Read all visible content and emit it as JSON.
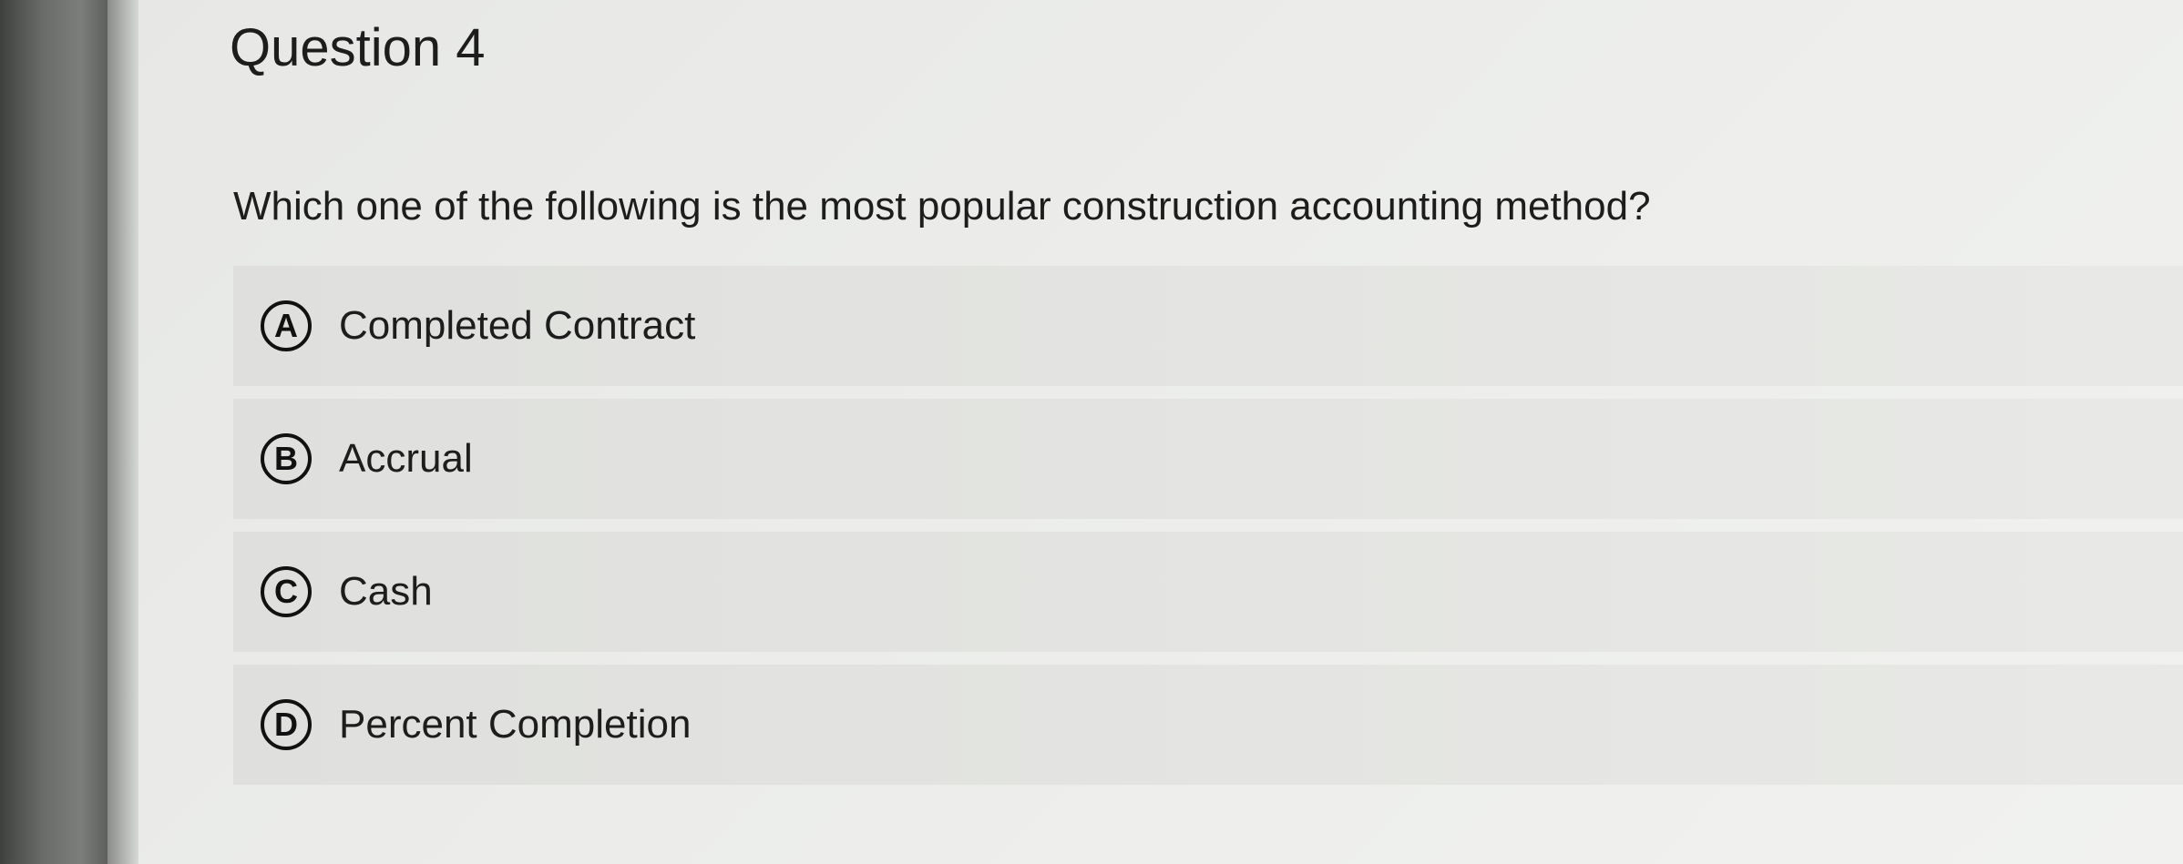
{
  "question": {
    "title": "Question 4",
    "prompt": "Which one of the following is the most popular construction accounting method?",
    "options": [
      {
        "letter": "A",
        "text": "Completed Contract"
      },
      {
        "letter": "B",
        "text": "Accrual"
      },
      {
        "letter": "C",
        "text": "Cash"
      },
      {
        "letter": "D",
        "text": "Percent Completion"
      }
    ]
  }
}
